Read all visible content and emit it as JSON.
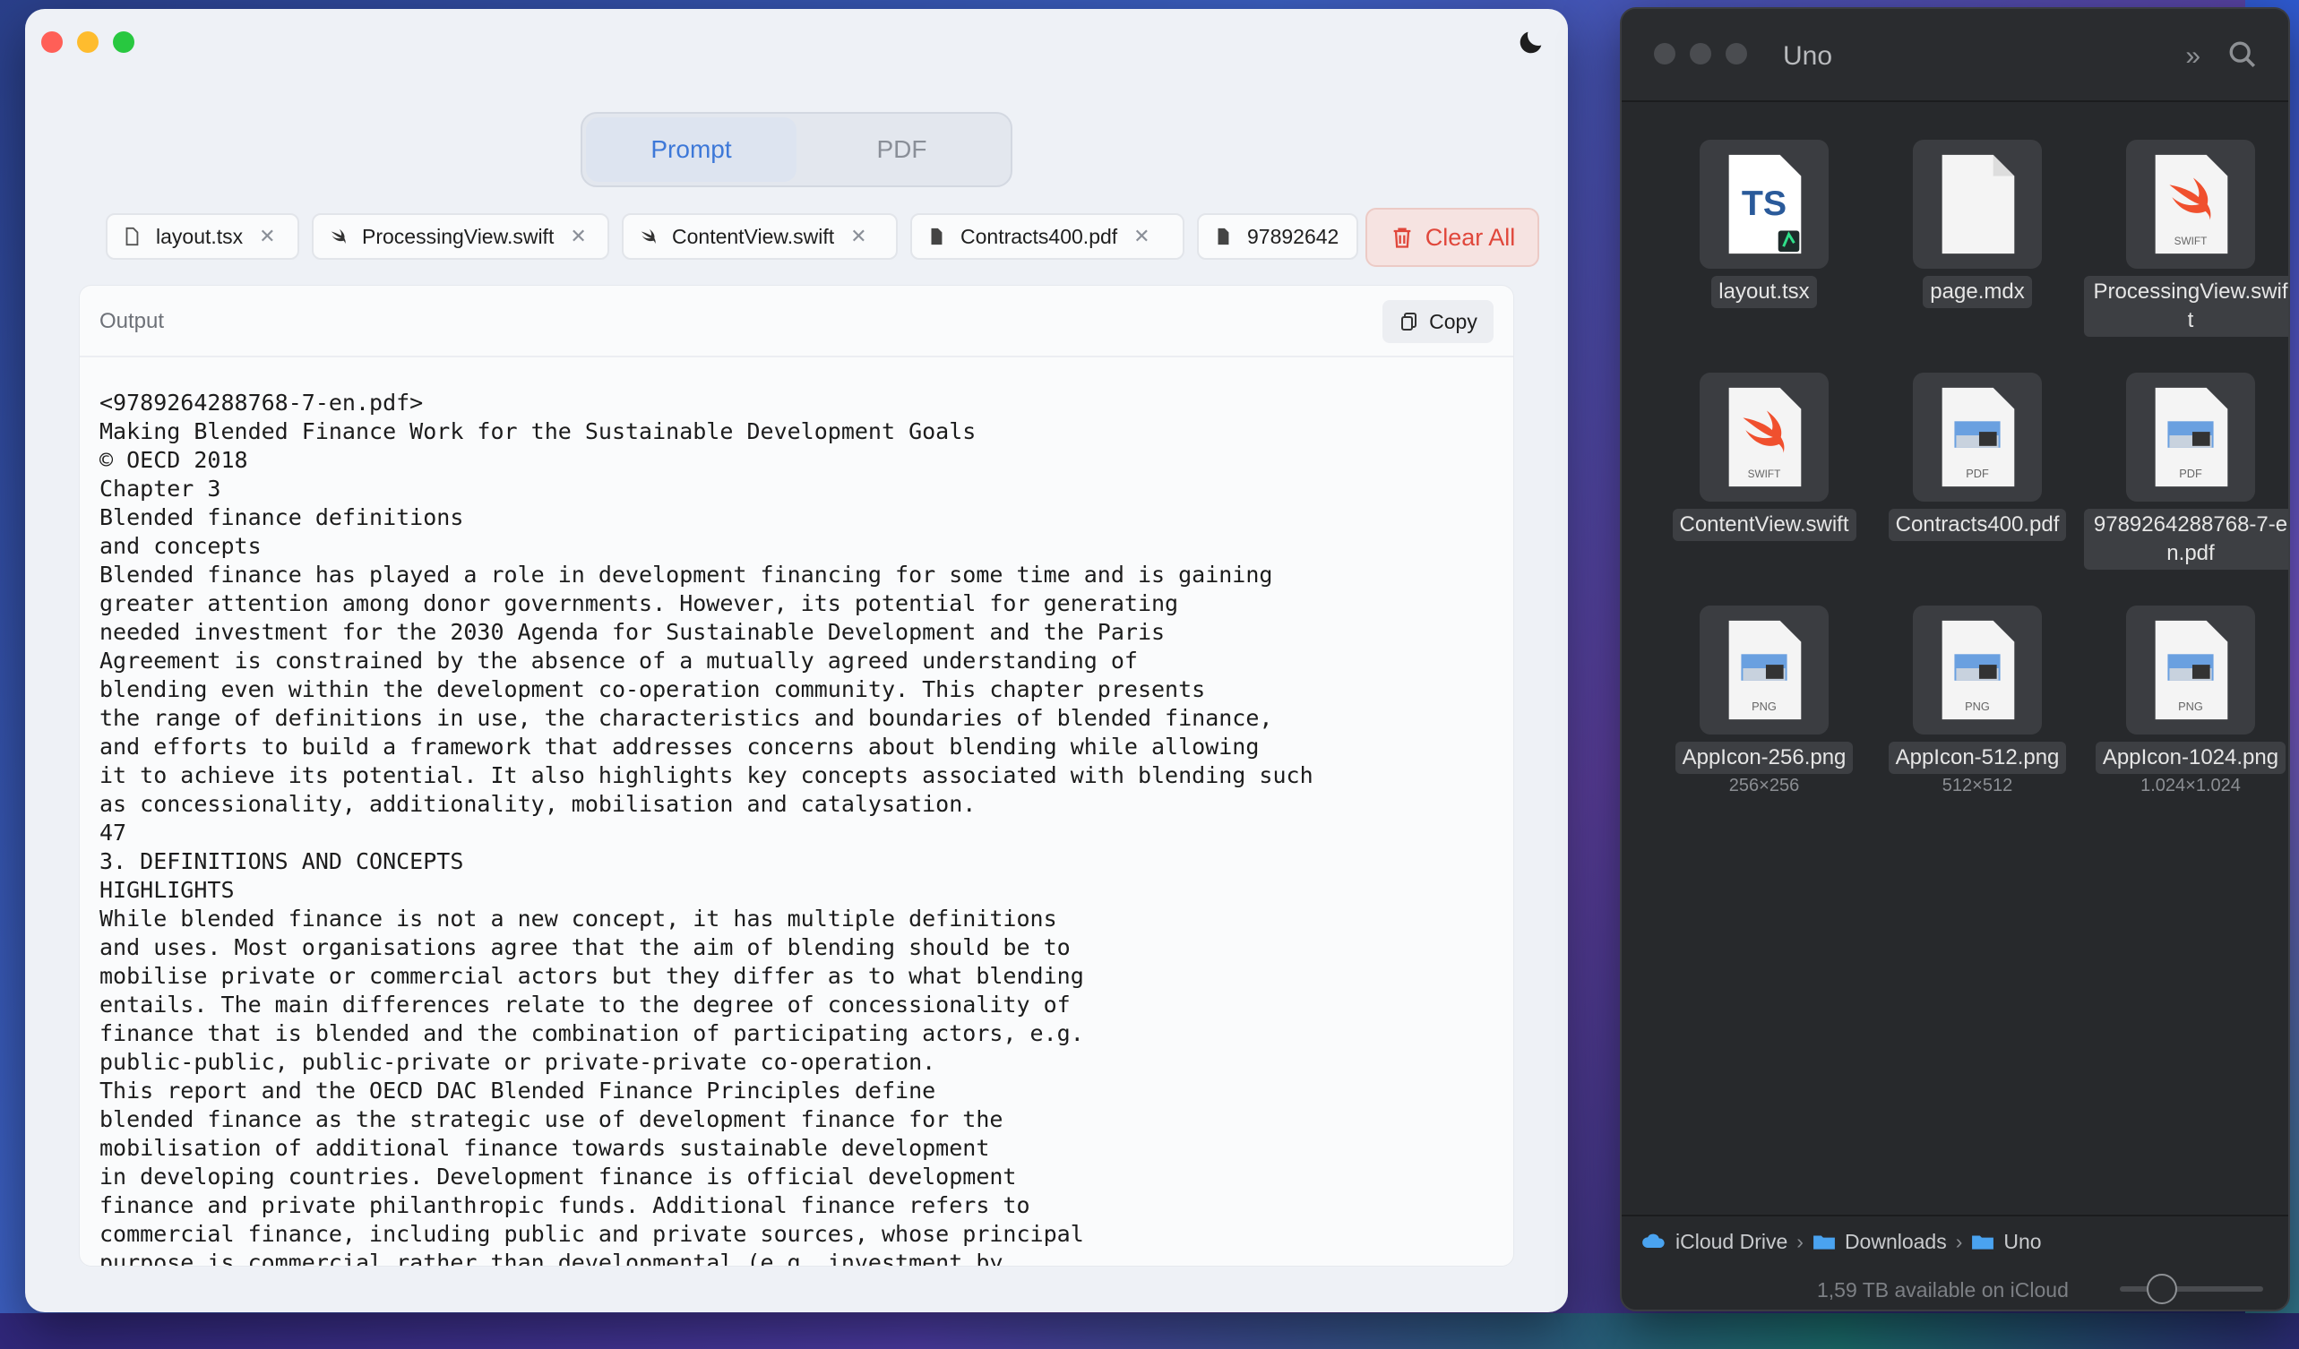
{
  "left_window": {
    "segments": [
      {
        "label": "Prompt",
        "active": true
      },
      {
        "label": "PDF",
        "active": false
      }
    ],
    "file_tabs": [
      {
        "name": "layout.tsx",
        "icon": "document-icon"
      },
      {
        "name": "ProcessingView.swift",
        "icon": "swift-icon"
      },
      {
        "name": "ContentView.swift",
        "icon": "swift-icon"
      },
      {
        "name": "Contracts400.pdf",
        "icon": "document-icon"
      },
      {
        "name": "97892642",
        "icon": "document-icon"
      }
    ],
    "clear_all_label": "Clear All",
    "output_label": "Output",
    "copy_label": "Copy",
    "output_lines": [
      "<9789264288768-7-en.pdf>",
      "Making Blended Finance Work for the Sustainable Development Goals",
      "© OECD 2018",
      "Chapter 3",
      "Blended finance definitions",
      "and concepts",
      "Blended finance has played a role in development financing for some time and is gaining",
      "greater attention among donor governments. However, its potential for generating",
      "needed investment for the 2030 Agenda for Sustainable Development and the Paris",
      "Agreement is constrained by the absence of a mutually agreed understanding of",
      "blending even within the development co-operation community. This chapter presents",
      "the range of definitions in use, the characteristics and boundaries of blended finance,",
      "and efforts to build a framework that addresses concerns about blending while allowing",
      "it to achieve its potential. It also highlights key concepts associated with blending such",
      "as concessionality, additionality, mobilisation and catalysation.",
      "47",
      "3. DEFINITIONS AND CONCEPTS",
      "HIGHLIGHTS",
      "While blended finance is not a new concept, it has multiple definitions",
      "and uses. Most organisations agree that the aim of blending should be to",
      "mobilise private or commercial actors but they differ as to what blending",
      "entails. The main differences relate to the degree of concessionality of",
      "finance that is blended and the combination of participating actors, e.g.",
      "public-public, public-private or private-private co-operation.",
      "This report and the OECD DAC Blended Finance Principles define",
      "blended finance as the strategic use of development finance for the",
      "mobilisation of additional finance towards sustainable development",
      "in developing countries. Development finance is official development",
      "finance and private philanthropic funds. Additional finance refers to",
      "commercial finance, including public and private sources, whose principal",
      "purpose is commercial rather than developmental (e.g. investment by"
    ]
  },
  "finder": {
    "title": "Uno",
    "items": [
      {
        "name": "layout.tsx",
        "type": "TS",
        "dims": ""
      },
      {
        "name": "page.mdx",
        "type": "",
        "dims": ""
      },
      {
        "name": "ProcessingView.swift",
        "type": "SWIFT",
        "dims": ""
      },
      {
        "name": "ContentView.swift",
        "type": "SWIFT",
        "dims": ""
      },
      {
        "name": "Contracts400.pdf",
        "type": "PDF",
        "dims": ""
      },
      {
        "name": "9789264288768-7-en.pdf",
        "type": "PDF",
        "dims": ""
      },
      {
        "name": "AppIcon-256.png",
        "type": "PNG",
        "dims": "256×256"
      },
      {
        "name": "AppIcon-512.png",
        "type": "PNG",
        "dims": "512×512"
      },
      {
        "name": "AppIcon-1024.png",
        "type": "PNG",
        "dims": "1.024×1.024"
      }
    ],
    "path": [
      "iCloud Drive",
      "Downloads",
      "Uno"
    ],
    "status": "1,59 TB available on iCloud"
  }
}
